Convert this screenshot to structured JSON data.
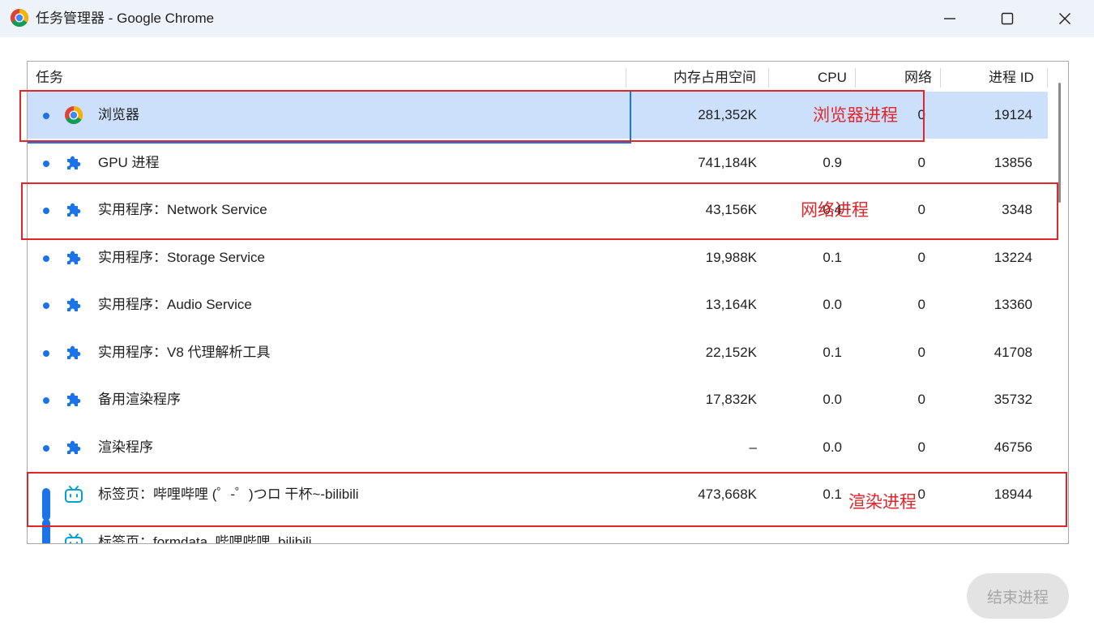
{
  "window": {
    "title": "任务管理器 - Google Chrome",
    "accent_color": "#1a73e8",
    "selected_row_color": "#cde0fb",
    "annotation_color": "#e0262b"
  },
  "table": {
    "columns": [
      "任务",
      "内存占用空间",
      "CPU",
      "网络",
      "进程 ID"
    ],
    "rows": [
      {
        "name": "浏览器",
        "icon": "chrome-icon",
        "memory": "281,352K",
        "cpu": "",
        "network": "0",
        "pid": "19124",
        "selected": true
      },
      {
        "name": "GPU 进程",
        "icon": "puzzle-icon",
        "memory": "741,184K",
        "cpu": "0.9",
        "network": "0",
        "pid": "13856"
      },
      {
        "name": "实用程序：Network Service",
        "icon": "puzzle-icon",
        "memory": "43,156K",
        "cpu": "0.4",
        "network": "0",
        "pid": "3348"
      },
      {
        "name": "实用程序：Storage Service",
        "icon": "puzzle-icon",
        "memory": "19,988K",
        "cpu": "0.1",
        "network": "0",
        "pid": "13224"
      },
      {
        "name": "实用程序：Audio Service",
        "icon": "puzzle-icon",
        "memory": "13,164K",
        "cpu": "0.0",
        "network": "0",
        "pid": "13360"
      },
      {
        "name": "实用程序：V8 代理解析工具",
        "icon": "puzzle-icon",
        "memory": "22,152K",
        "cpu": "0.1",
        "network": "0",
        "pid": "41708"
      },
      {
        "name": "备用渲染程序",
        "icon": "puzzle-icon",
        "memory": "17,832K",
        "cpu": "0.0",
        "network": "0",
        "pid": "35732"
      },
      {
        "name": "渲染程序",
        "icon": "puzzle-icon",
        "memory": "–",
        "cpu": "0.0",
        "network": "0",
        "pid": "46756"
      },
      {
        "name": "标签页：哔哩哔哩 (゜-゜)つロ 干杯~-bilibili",
        "icon": "bilibili-icon",
        "memory": "473,668K",
        "cpu": "0.1",
        "network": "0",
        "pid": "18944"
      },
      {
        "name": "标签页：formdata_哔哩哔哩_bilibili",
        "icon": "bilibili-icon",
        "memory": "",
        "cpu": "",
        "network": "",
        "pid": ""
      }
    ]
  },
  "annotations": [
    {
      "label": "浏览器进程"
    },
    {
      "label": "网络进程"
    },
    {
      "label": "渲染进程"
    }
  ],
  "footer": {
    "end_process_label": "结束进程"
  }
}
